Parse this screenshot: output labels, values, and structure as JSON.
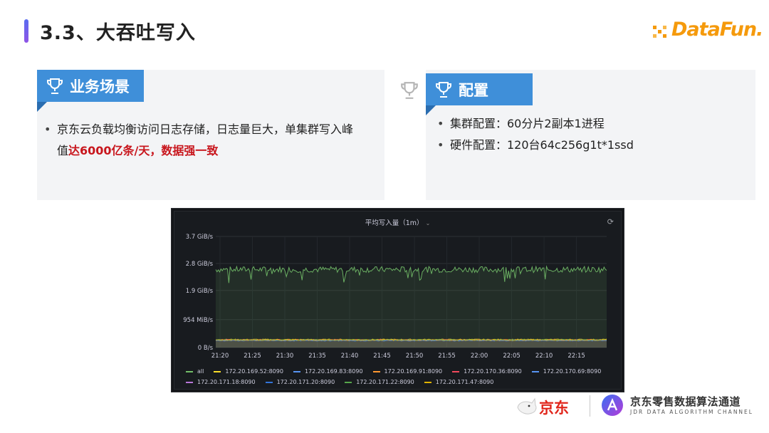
{
  "title": "3.3、大吞吐写入",
  "logo": {
    "text": "DataFun."
  },
  "left_card": {
    "badge": "业务场景",
    "line1": "京东云负载均衡访问日志存储，日志量巨大，单集群写入峰",
    "line2_prefix": "值",
    "line2_highlight": "达6000亿条/天，数据强一致"
  },
  "right_card": {
    "badge": "配置",
    "items": [
      "集群配置：60分片2副本1进程",
      "硬件配置：120台64c256g1t*1ssd"
    ]
  },
  "chart_data": {
    "type": "line",
    "title": "平均写入量（1m）",
    "y_ticks": [
      "3.7 GiB/s",
      "2.8 GiB/s",
      "1.9 GiB/s",
      "954 MiB/s",
      "0 B/s"
    ],
    "y_tick_values": [
      3.7,
      2.8,
      1.9,
      0.93,
      0
    ],
    "ylim": [
      0,
      3.7
    ],
    "x_ticks": [
      "21:20",
      "21:25",
      "21:30",
      "21:35",
      "21:40",
      "21:45",
      "21:50",
      "21:55",
      "22:00",
      "22:05",
      "22:10",
      "22:15"
    ],
    "x_range_min": [
      0,
      59
    ],
    "grid": true,
    "legend_position": "bottom",
    "series": [
      {
        "name": "all",
        "color": "#73bf69",
        "level": 2.6,
        "amp": 0.1,
        "values": []
      },
      {
        "name": "172.20.169.52:8090",
        "color": "#fade2a",
        "level": 0.27,
        "amp": 0.015
      },
      {
        "name": "172.20.169.83:8090",
        "color": "#5794f2",
        "level": 0.25,
        "amp": 0.015
      },
      {
        "name": "172.20.169.91:8090",
        "color": "#ff9830",
        "level": 0.24,
        "amp": 0.015
      },
      {
        "name": "172.20.170.36:8090",
        "color": "#f2495c",
        "level": 0.26,
        "amp": 0.015
      },
      {
        "name": "172.20.170.69:8090",
        "color": "#5794f2",
        "level": 0.23,
        "amp": 0.015
      },
      {
        "name": "172.20.171.18:8090",
        "color": "#b877d9",
        "level": 0.25,
        "amp": 0.015
      },
      {
        "name": "172.20.171.20:8090",
        "color": "#3274d9",
        "level": 0.24,
        "amp": 0.015
      },
      {
        "name": "172.20.171.22:8090",
        "color": "#56a64b",
        "level": 0.26,
        "amp": 0.015
      },
      {
        "name": "172.20.171.47:8090",
        "color": "#e0b400",
        "level": 0.25,
        "amp": 0.015
      }
    ]
  },
  "footer": {
    "jd": "京东",
    "cn": "京东零售数据算法通道",
    "en": "JDR DATA ALGORITHM CHANNEL"
  },
  "colors": {
    "accent_blue": "#3f8fd9",
    "highlight_red": "#c8161d",
    "brand_orange": "#f59a0c"
  }
}
